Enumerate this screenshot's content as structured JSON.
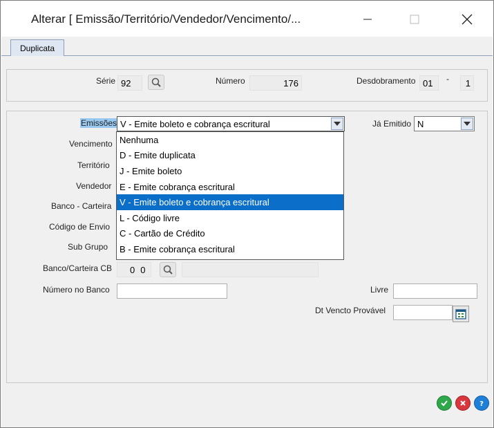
{
  "window": {
    "title": "Alterar  [ Emissão/Território/Vendedor/Vencimento/..."
  },
  "tabs": [
    {
      "label": "Duplicata"
    }
  ],
  "header": {
    "serie_label": "Série",
    "serie_value": "92",
    "numero_label": "Número",
    "numero_value": "176",
    "desdobramento_label": "Desdobramento",
    "desdobramento_value1": "01",
    "desdobramento_sep": "-",
    "desdobramento_value2": "1"
  },
  "form": {
    "emissoes_label": "Emissões",
    "emissoes_value": "V - Emite boleto e cobrança escritural",
    "ja_emitido_label": "Já Emitido",
    "ja_emitido_value": "N",
    "vencimento_label": "Vencimento",
    "territorio_label": "Território",
    "vendedor_label": "Vendedor",
    "banco_carteira_label": "Banco - Carteira",
    "codigo_envio_label": "Código de Envio",
    "sub_grupo_label": "Sub Grupo",
    "banco_carteira_cb_label": "Banco/Carteira CB",
    "banco_cb_value": "0",
    "carteira_cb_value": "0",
    "numero_banco_label": "Número no Banco",
    "numero_banco_value": "",
    "livre_label": "Livre",
    "livre_value": "",
    "dt_vencto_label": "Dt Vencto Provável",
    "dt_vencto_value": ""
  },
  "dropdown_options": [
    {
      "label": "Nenhuma",
      "selected": false
    },
    {
      "label": "D - Emite duplicata",
      "selected": false
    },
    {
      "label": "J  - Emite boleto",
      "selected": false
    },
    {
      "label": "E - Emite cobrança escritural",
      "selected": false
    },
    {
      "label": "V - Emite boleto e cobrança escritural",
      "selected": true
    },
    {
      "label": "L - Código livre",
      "selected": false
    },
    {
      "label": "C - Cartão de Crédito",
      "selected": false
    },
    {
      "label": "B - Emite cobrança escritural",
      "selected": false
    }
  ],
  "colors": {
    "selection": "#0b6fc9",
    "label_highlight": "#99c9ef",
    "ok": "#2ea84a",
    "cancel": "#d9363e",
    "help": "#1e7fd6"
  },
  "icons": {
    "serie_lookup": "magnifier-icon",
    "cb_lookup": "magnifier-icon",
    "calendar": "calendar-icon",
    "ok": "check-icon",
    "cancel": "x-icon",
    "help": "question-icon"
  }
}
